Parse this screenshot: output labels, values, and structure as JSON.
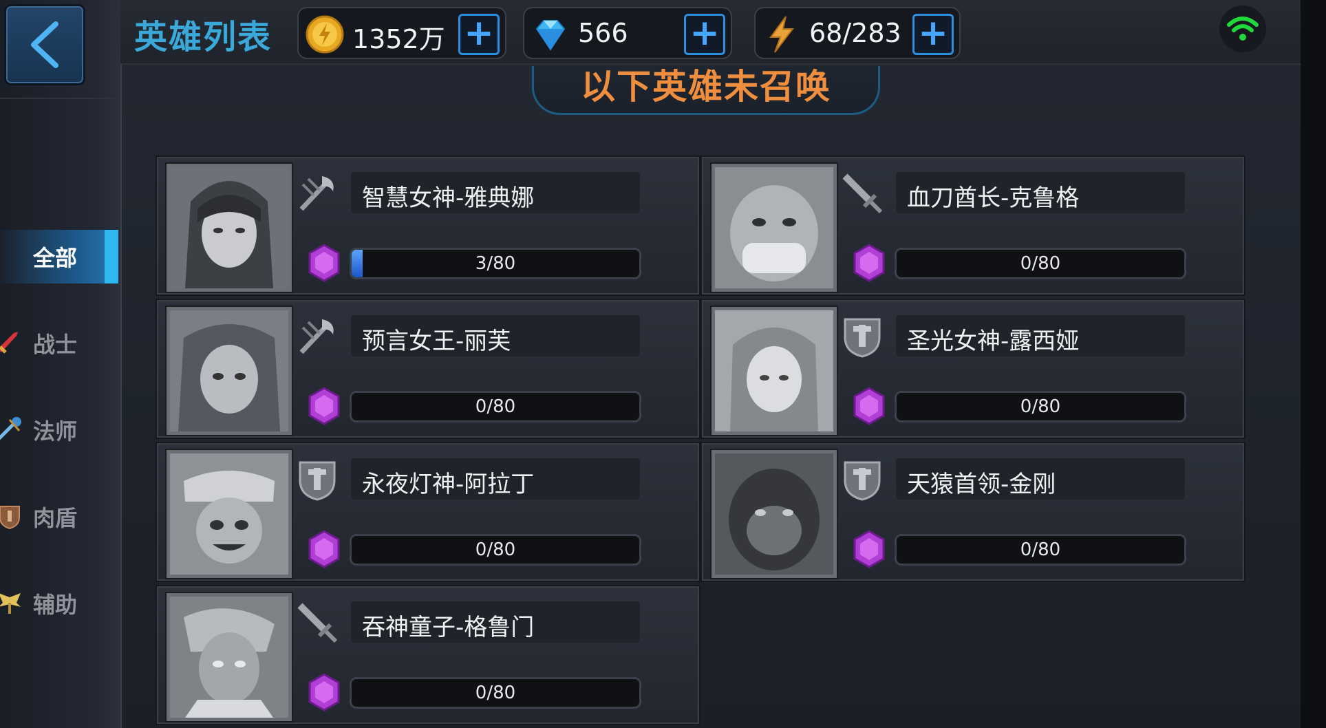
{
  "header": {
    "title": "英雄列表",
    "resources": [
      {
        "icon": "gold-coin-icon",
        "value": "1352万"
      },
      {
        "icon": "diamond-icon",
        "value": "566"
      },
      {
        "icon": "lightning-energy-icon",
        "value": "68/283"
      }
    ],
    "plus_label": "+"
  },
  "sidebar": {
    "items": [
      {
        "label": "全部",
        "icon": "",
        "active": true
      },
      {
        "label": "战士",
        "icon": "sword-icon",
        "active": false
      },
      {
        "label": "法师",
        "icon": "staff-icon",
        "active": false
      },
      {
        "label": "肉盾",
        "icon": "shield-icon",
        "active": false
      },
      {
        "label": "辅助",
        "icon": "wings-icon",
        "active": false
      }
    ]
  },
  "section": {
    "title": "以下英雄未召唤"
  },
  "heroes": [
    {
      "name": "智慧女神-雅典娜",
      "class_icon": "staff-class-icon",
      "progress_text": "3/80",
      "progress": 0.0375
    },
    {
      "name": "血刀酋长-克鲁格",
      "class_icon": "sword-class-icon",
      "progress_text": "0/80",
      "progress": 0
    },
    {
      "name": "预言女王-丽芙",
      "class_icon": "staff-class-icon",
      "progress_text": "0/80",
      "progress": 0
    },
    {
      "name": "圣光女神-露西娅",
      "class_icon": "shield-class-icon",
      "progress_text": "0/80",
      "progress": 0
    },
    {
      "name": "永夜灯神-阿拉丁",
      "class_icon": "shield-class-icon",
      "progress_text": "0/80",
      "progress": 0
    },
    {
      "name": "天猿首领-金刚",
      "class_icon": "shield-class-icon",
      "progress_text": "0/80",
      "progress": 0
    },
    {
      "name": "吞神童子-格鲁门",
      "class_icon": "sword-class-icon",
      "progress_text": "0/80",
      "progress": 0
    }
  ],
  "colors": {
    "accent_blue": "#2fb8f0",
    "title_blue": "#3aa8d8",
    "section_orange": "#ef8e3e",
    "gem_purple": "#b13fd6",
    "wifi_green": "#1ed93a"
  }
}
